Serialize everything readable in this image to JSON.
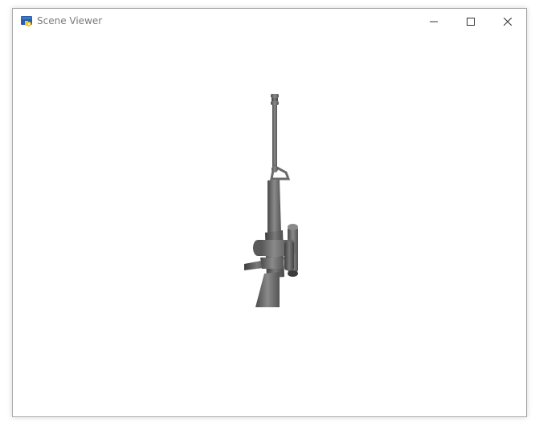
{
  "window": {
    "title": "Scene Viewer",
    "app_icon": "python-app-icon",
    "controls": {
      "minimize_icon": "minimize-icon",
      "maximize_icon": "maximize-icon",
      "close_icon": "close-icon"
    }
  },
  "viewport": {
    "background": "#ffffff",
    "model": {
      "name": "rifle-3d-model",
      "color": "#6a6a6a"
    }
  }
}
